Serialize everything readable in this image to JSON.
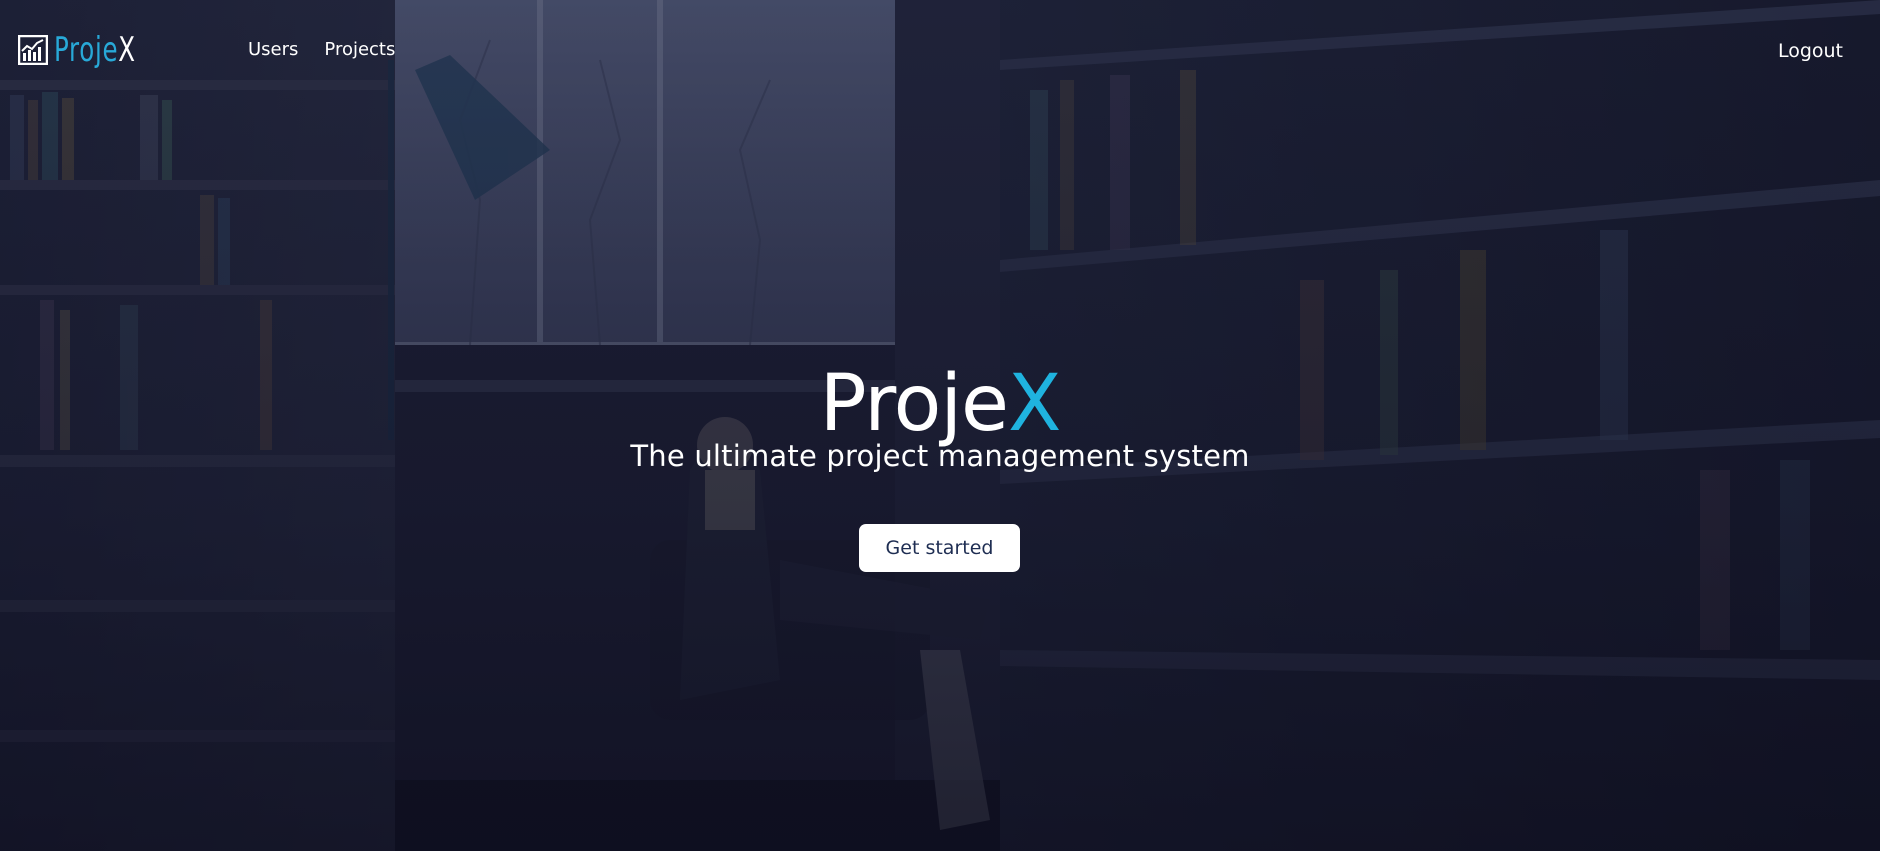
{
  "brand": {
    "part1": "Proje",
    "part2": "X",
    "icon": "bar-chart-icon",
    "accent_color": "#28a9d8"
  },
  "nav": {
    "links": [
      {
        "label": "Users"
      },
      {
        "label": "Projects"
      }
    ],
    "logout_label": "Logout"
  },
  "hero": {
    "title_part1": "Proje",
    "title_part2": "X",
    "title_accent_color": "#1fb3df",
    "subtitle": "The ultimate project management system",
    "cta_label": "Get started",
    "background": "library-photo"
  }
}
